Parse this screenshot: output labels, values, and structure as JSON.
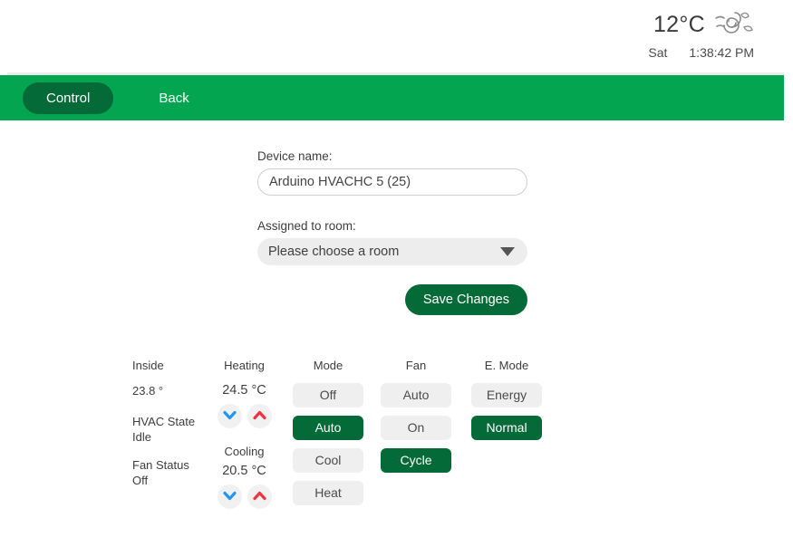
{
  "statusbar": {
    "temperature": "12°C",
    "weather_icon": "wind-breeze-icon",
    "day": "Sat",
    "time": "1:38:42 PM"
  },
  "nav": {
    "active_label": "Control",
    "back_label": "Back"
  },
  "form": {
    "device_name_label": "Device name:",
    "device_name_value": "Arduino HVACHC 5 (25)",
    "device_name_placeholder": "Device name",
    "room_label": "Assigned to room:",
    "room_selected": "Please choose a room",
    "save_label": "Save Changes"
  },
  "controls": {
    "status": {
      "header": "Inside",
      "inside_value": "23.8 °",
      "hvac_state_label": "HVAC State",
      "hvac_state_value": "Idle",
      "fan_status_label": "Fan Status",
      "fan_status_value": "Off"
    },
    "temps": {
      "heating_header": "Heating",
      "heating_value": "24.5 °C",
      "cooling_label": "Cooling",
      "cooling_value": "20.5 °C",
      "down_icon": "chevron-down-icon",
      "up_icon": "chevron-up-icon",
      "down_color": "#2196f3",
      "up_color": "#ef3340"
    },
    "mode": {
      "header": "Mode",
      "options": [
        {
          "label": "Off",
          "selected": false
        },
        {
          "label": "Auto",
          "selected": true
        },
        {
          "label": "Cool",
          "selected": false
        },
        {
          "label": "Heat",
          "selected": false
        }
      ]
    },
    "fan": {
      "header": "Fan",
      "options": [
        {
          "label": "Auto",
          "selected": false
        },
        {
          "label": "On",
          "selected": false
        },
        {
          "label": "Cycle",
          "selected": true
        }
      ]
    },
    "emode": {
      "header": "E. Mode",
      "options": [
        {
          "label": "Energy",
          "selected": false
        },
        {
          "label": "Normal",
          "selected": true
        }
      ]
    }
  },
  "theme": {
    "nav_green": "#04a550",
    "dark_green": "#046a38",
    "chip_gray": "#efefef"
  }
}
